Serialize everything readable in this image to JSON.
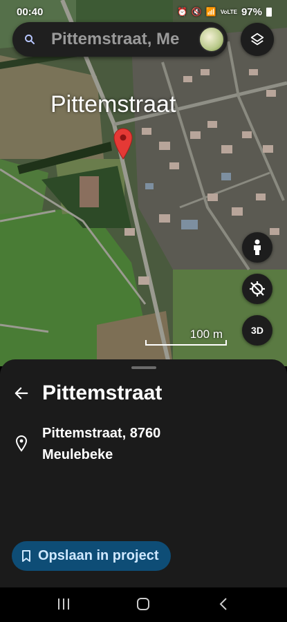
{
  "status": {
    "time": "00:40",
    "battery": "97%",
    "network": "VoLTE"
  },
  "search": {
    "query": "Pittemstraat, Me"
  },
  "map": {
    "place_label": "Pittemstraat",
    "scale_label": "100 m",
    "btn_3d": "3D"
  },
  "sheet": {
    "title": "Pittemstraat",
    "address_line1": "Pittemstraat, 8760",
    "address_line2": "Meulebeke",
    "save_label": "Opslaan in project"
  },
  "colors": {
    "accent": "#0e4d76",
    "pin": "#e53935",
    "sheet_bg": "#1b1b1b"
  }
}
